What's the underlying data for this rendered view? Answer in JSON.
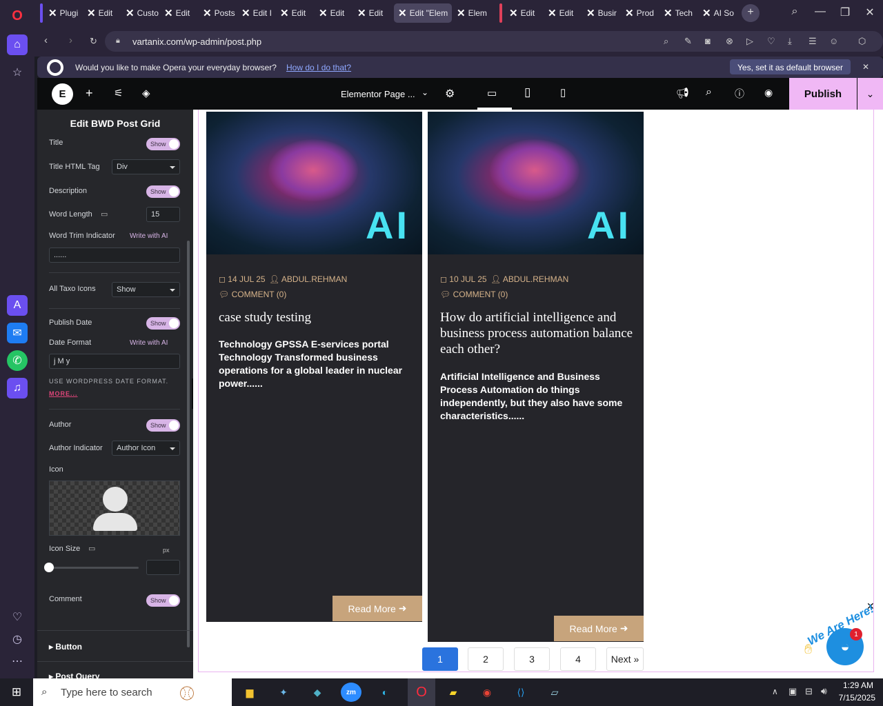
{
  "tabs": [
    "Plugi",
    "Edit ",
    "Custo",
    "Edit ",
    "Posts",
    "Edit I",
    "Edit ",
    "Edit ",
    "Edit ",
    "Edit \"Elem",
    "Elem",
    "Edit ",
    "Edit ",
    "Busir",
    "Prod",
    "Tech",
    "AI So"
  ],
  "url": "vartanix.com/wp-admin/post.php",
  "opera_bar": {
    "message": "Would you like to make Opera your everyday browser?",
    "link": "How do I do that?",
    "button": "Yes, set it as default browser"
  },
  "elementor": {
    "page_settings": "Elementor Page ...",
    "publish": "Publish"
  },
  "panel": {
    "title": "Edit BWD Post Grid",
    "title_label": "Title",
    "show": "Show",
    "title_html_tag": "Title HTML Tag",
    "tag_value": "Div",
    "description": "Description",
    "word_length": "Word Length",
    "word_length_value": "15",
    "word_trim": "Word Trim Indicator",
    "write_ai": "Write with AI",
    "trim_value": "......",
    "taxo_icons": "All Taxo Icons",
    "taxo_value": "Show",
    "publish_date": "Publish Date",
    "date_format": "Date Format",
    "date_value": "j M y",
    "date_note": "USE WORDPRESS DATE FORMAT.",
    "more": "MORE...",
    "author": "Author",
    "author_indicator": "Author Indicator",
    "author_ind_value": "Author Icon",
    "icon": "Icon",
    "icon_size": "Icon Size",
    "unit": "px",
    "comment": "Comment",
    "button_section": "Button",
    "query_section": "Post Query"
  },
  "cards": [
    {
      "date": "14 JUL 25",
      "author": "ABDUL.REHMAN",
      "comment": "COMMENT (0)",
      "title": "case study testing",
      "desc": "Technology GPSSA E-services portal Technology Transformed business operations for a global leader in nuclear power......",
      "read": "Read More",
      "img_text": "AI"
    },
    {
      "date": "10 JUL 25",
      "author": "ABDUL.REHMAN",
      "comment": "COMMENT (0)",
      "title": "How do artificial intelligence and business process automation balance each other?",
      "desc": "Artificial Intelligence and Business Process Automation do things independently, but they also have some characteristics......",
      "read": "Read More",
      "img_text": "AI"
    }
  ],
  "pagination": [
    "1",
    "2",
    "3",
    "4",
    "Next »"
  ],
  "chat_badge": "1",
  "chat_label": "We Are Here!",
  "taskbar": {
    "search": "Type here to search",
    "time": "1:29 AM",
    "date": "7/15/2025"
  }
}
